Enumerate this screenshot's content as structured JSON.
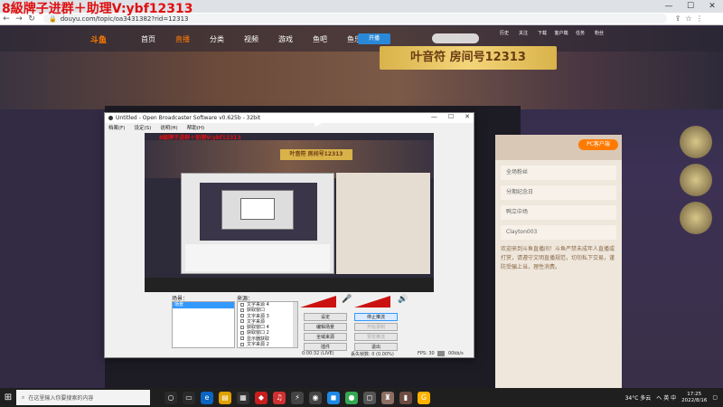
{
  "overlay_title": "8級牌子进群＋助理V:ybf12313",
  "browser": {
    "url": "douyu.com/topic/oa3431382?rid=12313",
    "window_controls": [
      "—",
      "☐",
      "✕"
    ]
  },
  "douyu": {
    "logo": "斗鱼",
    "menu": [
      "首页",
      "直播",
      "分类",
      "视频",
      "游戏",
      "鱼吧",
      "鱼乐盛典"
    ],
    "active_menu": "直播",
    "live_button": "开播",
    "nav_icons": [
      "历史",
      "关注",
      "下载",
      "客户端",
      "任务",
      "粉丝"
    ],
    "room_banner": "叶音符 房间号12313",
    "pc_button": "PC客户端",
    "side_rows": [
      "全场粉丝",
      "分期纪念日",
      "鸭立中场",
      "Clayton003"
    ],
    "side_text": "欢迎来到斗鱼直播间！斗鱼严禁未成年人直播或打赏，请遵守文明直播规范，切勿私下交易，谨防受骗上当，理性消费。"
  },
  "obs": {
    "title": "Untitled - Open Broadcaster Software v0.625b - 32bit",
    "menu": [
      "档案(F)",
      "设定(S)",
      "说明(H)",
      "帮助(H)"
    ],
    "preview_overlay": "8級牌子进群＋助理V:ybf12313",
    "preview_banner": "叶音符 房间号12313",
    "scenes_label": "场景：",
    "sources_label": "来源：",
    "scenes": [
      "场景"
    ],
    "sources": [
      "文字来源 4",
      "获取窗口",
      "文字来源 3",
      "文字来源",
      "获取窗口 4",
      "获取窗口 2",
      "显示器获取",
      "文字来源 2"
    ],
    "buttons": [
      {
        "label": "设定",
        "state": "normal"
      },
      {
        "label": "停止推流",
        "state": "highlight"
      },
      {
        "label": "编辑场景",
        "state": "normal"
      },
      {
        "label": "开始录制",
        "state": "disabled"
      },
      {
        "label": "全域来源",
        "state": "normal"
      },
      {
        "label": "预览推流",
        "state": "disabled"
      },
      {
        "label": "插件",
        "state": "normal"
      },
      {
        "label": "退出",
        "state": "normal"
      }
    ],
    "status": {
      "time": "0:00:32 (LIVE)",
      "dropped": "丢失帧数: 0 (0.00%)",
      "fps": "FPS: 30",
      "kbps": "00kb/s"
    }
  },
  "taskbar": {
    "search_placeholder": "在这里输入你要搜索的内容",
    "weather": "34°C 多云",
    "tray": "へ 英 中",
    "time": "17:25",
    "date": "2022/8/16"
  }
}
